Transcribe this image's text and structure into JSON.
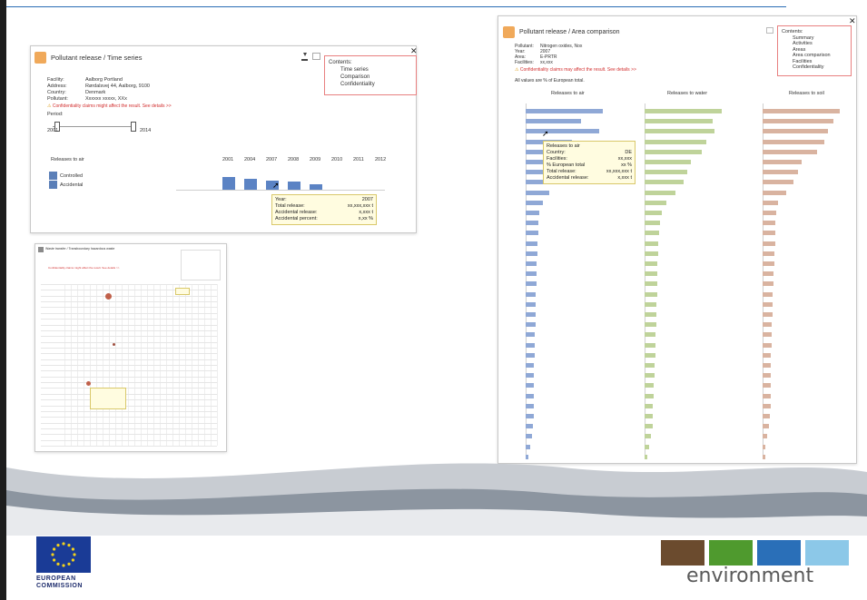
{
  "window_time_series": {
    "title": "Pollutant release / Time series",
    "contents_title": "Contents:",
    "contents_items": [
      "Time series",
      "Comparison",
      "Confidentiality"
    ],
    "facility_label": "Facility:",
    "facility": "Aalborg Portland",
    "address_label": "Address:",
    "address": "Rørdalsvej 44, Aalborg, 9100",
    "country_label": "Country:",
    "country": "Denmark",
    "pollutant_label": "Pollutant:",
    "pollutant": "Xxxxxx xxxxx, XXx",
    "warning": "Confidentiality claims might affect the result. See details >>",
    "period_label": "Period:",
    "period_start": "2001",
    "period_end": "2014",
    "releases_label": "Releases to air",
    "years": [
      "2001",
      "2004",
      "2007",
      "2008",
      "2009",
      "2010",
      "2011",
      "2012"
    ],
    "legend_controlled": "Controlled",
    "legend_accidental": "Accidental",
    "colors": {
      "bar": "#5b83c4",
      "controlled": "#5b7fb8",
      "accidental": "#5b7fb8"
    },
    "tooltip": {
      "year_label": "Year:",
      "year": "2007",
      "total_label": "Total release:",
      "total": "xx,xxx,xxx t",
      "accidental_label": "Accidental release:",
      "accidental": "x,xxx t",
      "percent_label": "Accidental percent:",
      "percent": "x,xx %"
    }
  },
  "window_area": {
    "title": "Pollutant release / Area comparison",
    "contents_title": "Contents:",
    "contents_items": [
      "Summary",
      "Activities",
      "Areas",
      "Area comparison",
      "Facilities",
      "Confidentiality"
    ],
    "pollutant_label": "Pollutant:",
    "pollutant": "Nitrogen oxides, Nox",
    "year_label": "Year:",
    "year": "2007",
    "area_label": "Area:",
    "area": "E-PRTR",
    "facilities_label": "Facilities:",
    "facilities": "xx,xxx",
    "warning": "Confidentiality claims may affect the result. See details >>",
    "note": "All values are % of European total.",
    "col_air": "Releases to air",
    "col_water": "Releases to water",
    "col_soil": "Releases to soil",
    "colors": {
      "air": "#8fa8d6",
      "water": "#bfd39a",
      "soil": "#d9b3a0"
    },
    "air_values": [
      100,
      72,
      95,
      60,
      78,
      50,
      40,
      45,
      30,
      22,
      18,
      16,
      16,
      15,
      15,
      14,
      14,
      14,
      13,
      13,
      13,
      13,
      12,
      12,
      12,
      11,
      11,
      11,
      10,
      10,
      10,
      9,
      8,
      6,
      4
    ],
    "water_values": [
      100,
      88,
      90,
      80,
      74,
      60,
      55,
      50,
      40,
      28,
      22,
      20,
      19,
      18,
      18,
      17,
      17,
      16,
      16,
      15,
      15,
      15,
      14,
      14,
      14,
      13,
      13,
      12,
      12,
      11,
      11,
      10,
      8,
      6,
      4
    ],
    "soil_values": [
      100,
      92,
      85,
      80,
      70,
      50,
      46,
      40,
      30,
      20,
      18,
      17,
      16,
      16,
      15,
      15,
      14,
      14,
      13,
      13,
      13,
      12,
      12,
      12,
      11,
      11,
      11,
      10,
      10,
      10,
      9,
      8,
      6,
      4,
      3
    ],
    "tooltip": {
      "title": "Releases to air",
      "country_label": "Country:",
      "country": "DE",
      "facilities_label": "Facilities:",
      "facilities": "xx,xxx",
      "percent_label": "% European total",
      "percent": "xx %",
      "total_label": "Total release:",
      "total": "xx,xxx,xxx t",
      "accidental_label": "Accidental release:",
      "accidental": "x,xxx t"
    }
  },
  "window_transboundary": {
    "title": "Waste transfer / Transboundary hazardous waste",
    "warning": "Confidentiality claims might affect the result. See details >>",
    "bubble_color": "#c0604a"
  },
  "footer": {
    "eu_line1": "EUROPEAN",
    "eu_line2": "COMMISSION",
    "env": "environment"
  }
}
